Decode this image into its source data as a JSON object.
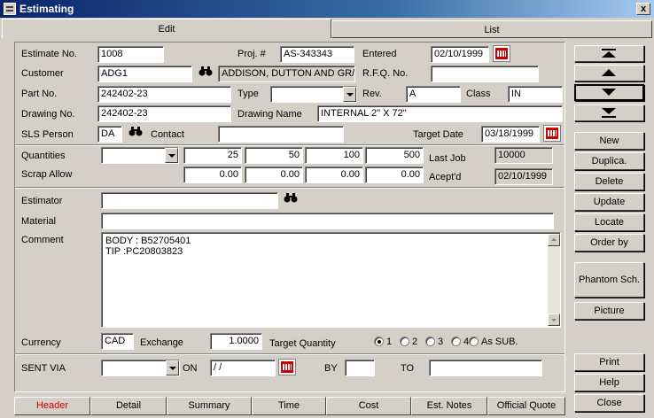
{
  "window": {
    "title": "Estimating",
    "close": "x"
  },
  "tabs": [
    {
      "label": "Edit"
    },
    {
      "label": "List"
    }
  ],
  "header": {
    "estimate_no_label": "Estimate No.",
    "estimate_no": "1008",
    "proj_label": "Proj. #",
    "proj": "AS-343343",
    "entered_label": "Entered",
    "entered": "02/10/1999",
    "customer_label": "Customer",
    "customer_code": "ADG1",
    "customer_name": "ADDISON, DUTTON AND GR/",
    "rfq_label": "R.F.Q. No.",
    "rfq": "",
    "part_label": "Part No.",
    "part": "242402-23",
    "type_label": "Type",
    "type": "",
    "rev_label": "Rev.",
    "rev": "A",
    "class_label": "Class",
    "class_val": "IN",
    "drawing_no_label": "Drawing  No.",
    "drawing_no": "242402-23",
    "drawing_name_label": "Drawing Name",
    "drawing_name": "INTERNAL 2\" X 72\"",
    "sls_label": "SLS Person",
    "sls": "DA",
    "contact_label": "Contact",
    "contact": "",
    "target_date_label": "Target Date",
    "target_date": "03/18/1999"
  },
  "quantities": {
    "label": "Quantities",
    "scrap_label": "Scrap Allow",
    "select": "",
    "qty": [
      "25",
      "50",
      "100",
      "500"
    ],
    "scrap": [
      "0.00",
      "0.00",
      "0.00",
      "0.00"
    ],
    "last_job_label": "Last Job",
    "last_job": "10000",
    "accepted_label": "Acept'd",
    "accepted": "02/10/1999"
  },
  "details": {
    "estimator_label": "Estimator",
    "estimator": "",
    "material_label": "Material",
    "material": "",
    "comment_label": "Comment",
    "comment_lines": [
      "BODY : B52705401",
      "TIP :PC20803823"
    ],
    "currency_label": "Currency",
    "currency": "CAD",
    "exchange_label": "Exchange",
    "exchange": "1.0000",
    "target_qty_label": "Target Quantity",
    "target_options": [
      {
        "label": "1",
        "selected": true
      },
      {
        "label": "2",
        "selected": false
      },
      {
        "label": "3",
        "selected": false
      },
      {
        "label": "4",
        "selected": false
      },
      {
        "label": "As SUB.",
        "selected": false
      }
    ]
  },
  "shipping": {
    "sent_via_label": "SENT VIA",
    "sent_via": "",
    "on_label": "ON",
    "on_date": " /  /",
    "by_label": "BY",
    "by": "",
    "to_label": "TO",
    "to": ""
  },
  "side_buttons": {
    "new": "New",
    "duplicate": "Duplica.",
    "delete": "Delete",
    "update": "Update",
    "locate": "Locate",
    "order_by": "Order by",
    "phantom": "Phantom Sch.",
    "picture": "Picture",
    "print": "Print",
    "help": "Help",
    "close": "Close"
  },
  "bottom_tabs": [
    {
      "label": "Header",
      "color": "#cc0000"
    },
    {
      "label": "Detail"
    },
    {
      "label": "Summary"
    },
    {
      "label": "Time"
    },
    {
      "label": "Cost"
    },
    {
      "label": "Est. Notes"
    },
    {
      "label": "Official Quote"
    }
  ]
}
